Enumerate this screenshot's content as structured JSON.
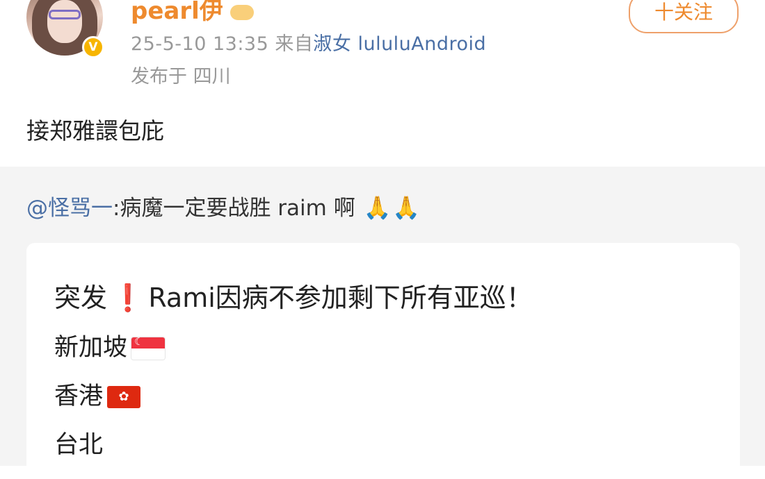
{
  "post": {
    "username": "pearl伊",
    "verified_badge": "V",
    "follow_label": "十关注",
    "timestamp": "25-5-10 13:35",
    "source_prefix": "来自",
    "source": "淑女 lululuAndroid",
    "location": "发布于 四川",
    "text": "接郑雅譞包庇"
  },
  "repost": {
    "mention": "@怪骂一",
    "text": ":病魔一定要战胜 raim 啊",
    "emoji": [
      "🙏",
      "🙏"
    ]
  },
  "card": {
    "title_prefix": "突发",
    "title_mark": "❗",
    "title_rest": "Rami因病不参加剩下所有亚巡！",
    "items": [
      {
        "label": "新加坡",
        "flag": "singapore-flag"
      },
      {
        "label": "香港",
        "flag": "hong-kong-flag"
      },
      {
        "label": "台北",
        "flag": ""
      }
    ]
  },
  "colors": {
    "username": "#ee8a2e",
    "link": "#4a6fa5",
    "meta": "#999999",
    "repost_bg": "#f4f4f4",
    "alert": "#e02020"
  }
}
